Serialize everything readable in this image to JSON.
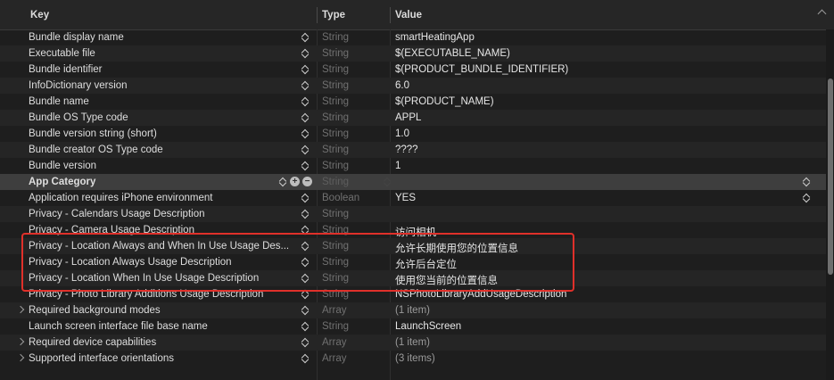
{
  "header": {
    "key": "Key",
    "type": "Type",
    "value": "Value"
  },
  "rows": [
    {
      "key": "Bundle display name",
      "type": "String",
      "value": "smartHeatingApp"
    },
    {
      "key": "Executable file",
      "type": "String",
      "value": "$(EXECUTABLE_NAME)"
    },
    {
      "key": "Bundle identifier",
      "type": "String",
      "value": "$(PRODUCT_BUNDLE_IDENTIFIER)"
    },
    {
      "key": "InfoDictionary version",
      "type": "String",
      "value": "6.0"
    },
    {
      "key": "Bundle name",
      "type": "String",
      "value": "$(PRODUCT_NAME)"
    },
    {
      "key": "Bundle OS Type code",
      "type": "String",
      "value": "APPL"
    },
    {
      "key": "Bundle version string (short)",
      "type": "String",
      "value": "1.0"
    },
    {
      "key": "Bundle creator OS Type code",
      "type": "String",
      "value": "????"
    },
    {
      "key": "Bundle version",
      "type": "String",
      "value": "1"
    },
    {
      "key": "App Category",
      "type": "String",
      "value": ""
    },
    {
      "key": "Application requires iPhone environment",
      "type": "Boolean",
      "value": "YES"
    },
    {
      "key": "Privacy - Calendars Usage Description",
      "type": "String",
      "value": ""
    },
    {
      "key": "Privacy - Camera Usage Description",
      "type": "String",
      "value": "访问相机"
    },
    {
      "key": "Privacy - Location Always and When In Use Usage Des...",
      "type": "String",
      "value": "允许长期使用您的位置信息"
    },
    {
      "key": "Privacy - Location Always Usage Description",
      "type": "String",
      "value": "允许后台定位"
    },
    {
      "key": "Privacy - Location When In Use Usage Description",
      "type": "String",
      "value": "使用您当前的位置信息"
    },
    {
      "key": "Privacy - Photo Library Additions Usage Description",
      "type": "String",
      "value": "NSPhotoLibraryAddUsageDescription"
    },
    {
      "key": "Required background modes",
      "type": "Array",
      "value": "(1 item)"
    },
    {
      "key": "Launch screen interface file base name",
      "type": "String",
      "value": "LaunchScreen"
    },
    {
      "key": "Required device capabilities",
      "type": "Array",
      "value": "(1 item)"
    },
    {
      "key": "Supported interface orientations",
      "type": "Array",
      "value": "(3 items)"
    }
  ],
  "controls": {
    "add": "+",
    "remove": "−"
  }
}
